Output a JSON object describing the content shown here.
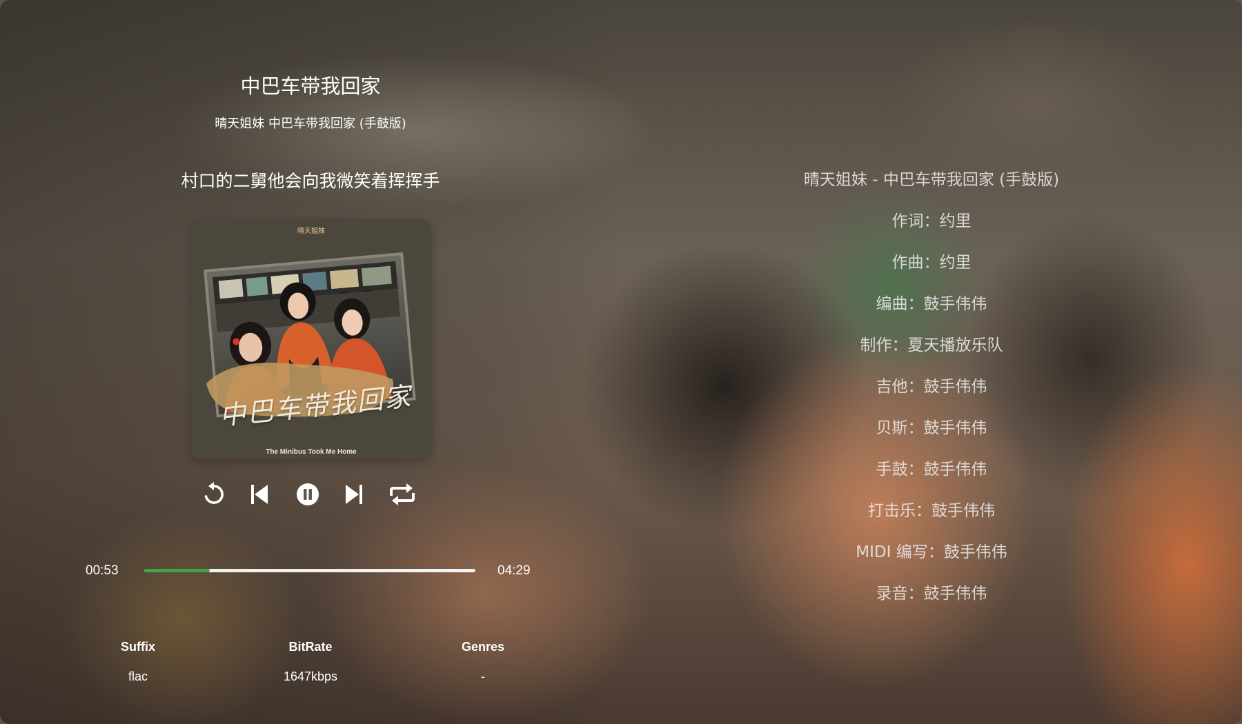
{
  "player": {
    "title": "中巴车带我回家",
    "subtitle": "晴天姐妹 中巴车带我回家 (手鼓版)",
    "current_lyric": "村口的二舅他会向我微笑着挥挥手",
    "cover": {
      "top_text": "晴天姐妹",
      "art_title": "中巴车带我回家",
      "bottom_text": "The Minibus Took Me Home"
    },
    "controls": {
      "replay_icon": "replay-icon",
      "prev_icon": "skip-previous-icon",
      "pause_icon": "pause-icon",
      "next_icon": "skip-next-icon",
      "repeat_icon": "repeat-icon"
    },
    "progress": {
      "current_time": "00:53",
      "total_time": "04:29",
      "fraction": 0.197,
      "fill_color": "#3fa34a",
      "track_color": "#ffffff"
    },
    "info": [
      {
        "label": "Suffix",
        "value": "flac"
      },
      {
        "label": "BitRate",
        "value": "1647kbps"
      },
      {
        "label": "Genres",
        "value": "-"
      }
    ]
  },
  "lyrics": [
    "晴天姐妹 - 中巴车带我回家 (手鼓版)",
    "作词：约里",
    "作曲：约里",
    "编曲：鼓手伟伟",
    "制作：夏天播放乐队",
    "吉他：鼓手伟伟",
    "贝斯：鼓手伟伟",
    "手鼓：鼓手伟伟",
    "打击乐：鼓手伟伟",
    "MIDI 编写：鼓手伟伟",
    "录音：鼓手伟伟"
  ]
}
